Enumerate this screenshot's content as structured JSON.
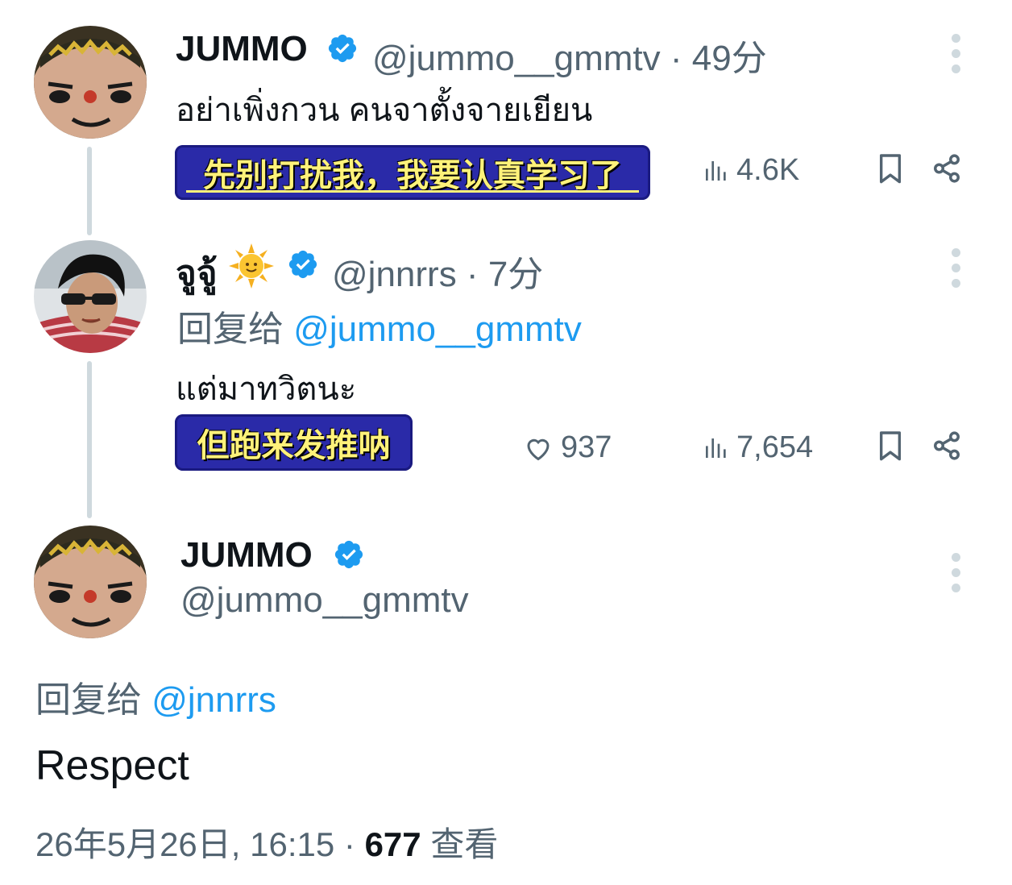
{
  "tweet1": {
    "name": "JUMMO",
    "handle": "@jummo__gmmtv",
    "separator": "·",
    "time": "49分",
    "text": "อย่าเพิ่งกวน คนจาตั้งจายเยียน",
    "banner_text": "先别打扰我，我要认真学习了",
    "views": "4.6K"
  },
  "tweet2": {
    "name": "จูจู้",
    "emoji": "🌞",
    "handle": "@jnnrrs",
    "separator": "·",
    "time": "7分",
    "reply_prefix": "回复给",
    "reply_mention": "@jummo__gmmtv",
    "text": "แต่มาทวิตนะ",
    "banner_text": "但跑来发推呐",
    "likes": "937",
    "views": "7,654"
  },
  "tweet3": {
    "name": "JUMMO",
    "handle": "@jummo__gmmtv",
    "reply_prefix": "回复给",
    "reply_mention": "@jnnrrs",
    "text": "Respect",
    "timestamp": "26年5月26日, 16:15",
    "separator": "·",
    "view_count": "677",
    "view_label": "查看"
  },
  "colors": {
    "text": "#0f1419",
    "secondary": "#536471",
    "accent": "#1d9bf0",
    "thread_line": "#cfd9de",
    "banner_bg": "#2a2aa8",
    "banner_text": "#fff27a"
  },
  "icons": [
    "verified-badge-icon",
    "more-options-icon",
    "views-icon",
    "bookmark-icon",
    "share-icon",
    "like-icon"
  ]
}
